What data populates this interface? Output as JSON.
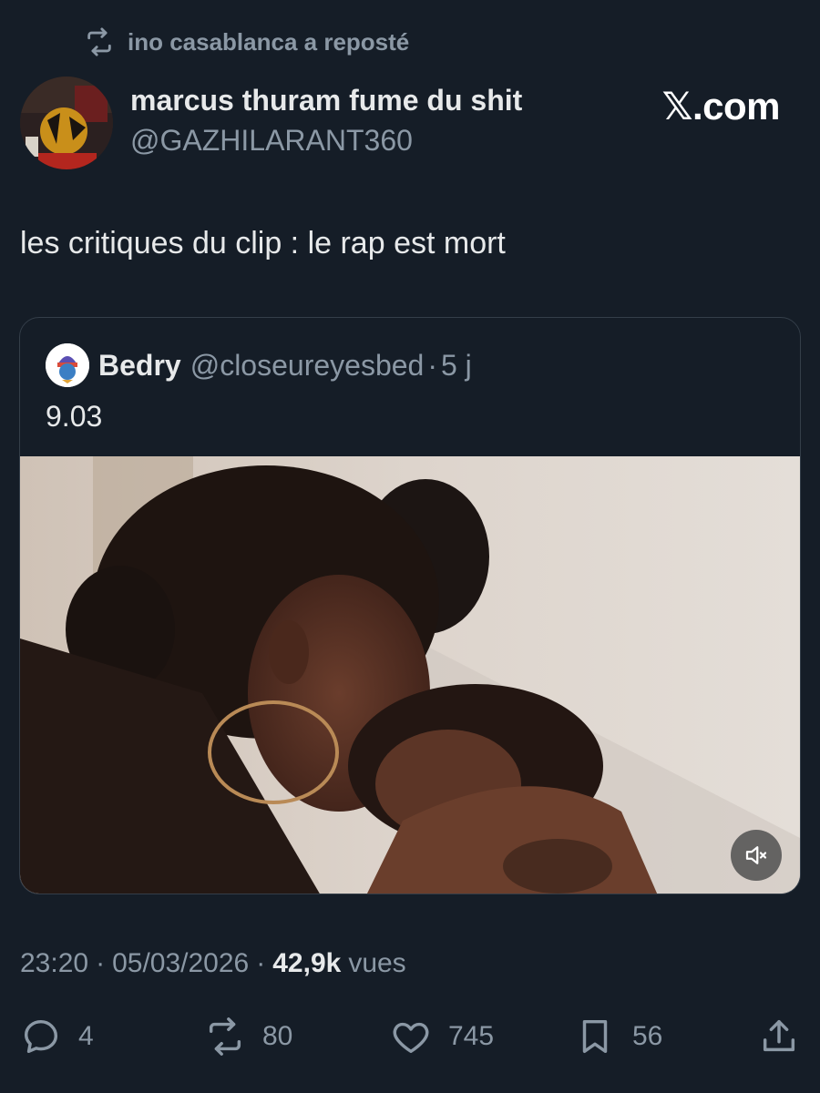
{
  "repost": {
    "text": "ino casablanca a reposté",
    "icon": "repost-icon"
  },
  "author": {
    "display_name": "marcus thuram fume du shit",
    "handle": "@GAZHILARANT360"
  },
  "brand": "𝕏.com",
  "tweet": {
    "text": "les critiques du clip : le rap est mort"
  },
  "quote": {
    "name": "Bedry",
    "handle": "@closeureyesbed",
    "dot": "·",
    "age": "5 j",
    "text": "9.03",
    "media": {
      "type": "video",
      "muted": true,
      "mute_icon": "volume-muted-icon"
    }
  },
  "meta": {
    "time": "23:20",
    "sep1": "·",
    "date": "05/03/2026",
    "sep2": "·",
    "views_count": "42,9k",
    "views_label": "vues"
  },
  "actions": {
    "replies": "4",
    "reposts": "80",
    "likes": "745",
    "bookmarks": "56"
  },
  "colors": {
    "background": "#151d27",
    "primary_text": "#e7e9ea",
    "secondary_text": "#8b98a5",
    "border": "#343e49"
  }
}
